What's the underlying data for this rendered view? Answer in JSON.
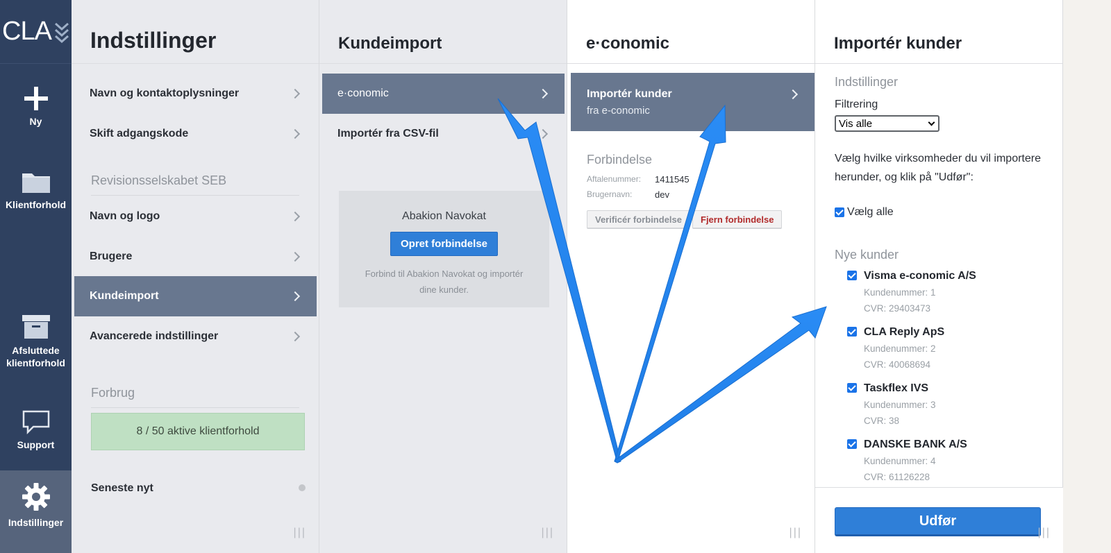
{
  "rail": {
    "logo": "CLA",
    "items": [
      {
        "label": "Ny"
      },
      {
        "label": "Klientforhold"
      },
      {
        "label": "Afsluttede klientforhold"
      },
      {
        "label": "Support"
      },
      {
        "label": "Indstillinger"
      }
    ]
  },
  "settings": {
    "title": "Indstillinger",
    "items": [
      {
        "label": "Navn og kontaktoplysninger"
      },
      {
        "label": "Skift adgangskode"
      },
      {
        "label": "Navn og logo"
      },
      {
        "label": "Brugere"
      },
      {
        "label": "Kundeimport"
      },
      {
        "label": "Avancerede indstillinger"
      }
    ],
    "company_section": "Revisionsselskabet SEB",
    "usage_section": "Forbrug",
    "usage_text": "8 / 50 aktive klientforhold",
    "news": "Seneste nyt"
  },
  "import": {
    "title": "Kundeimport",
    "items": [
      {
        "label": "e·conomic"
      },
      {
        "label": "Importér fra CSV-fil"
      }
    ],
    "card": {
      "title": "Abakion Navokat",
      "button": "Opret forbindelse",
      "desc": "Forbind til Abakion Navokat og importér dine kunder."
    }
  },
  "economic": {
    "title": "e·conomic",
    "item_line1": "Importér kunder",
    "item_line2": "fra e-conomic",
    "conn_title": "Forbindelse",
    "agreement_label": "Aftalenummer:",
    "agreement_value": "1411545",
    "user_label": "Brugernavn:",
    "user_value": "dev",
    "verify_button": "Verificér forbindelse",
    "remove_button": "Fjern forbindelse"
  },
  "importpanel": {
    "title": "Importér kunder",
    "settings_section": "Indstillinger",
    "filter_label": "Filtrering",
    "filter_value": "Vis alle",
    "instructions": "Vælg hvilke virksomheder du vil importere herunder, og klik på \"Udfør\":",
    "select_all": "Vælg alle",
    "new_section": "Nye kunder",
    "customers": [
      {
        "name": "Visma e-conomic A/S",
        "number": "Kundenummer: 1",
        "cvr": "CVR: 29403473"
      },
      {
        "name": "CLA Reply ApS",
        "number": "Kundenummer: 2",
        "cvr": "CVR: 40068694"
      },
      {
        "name": "Taskflex IVS",
        "number": "Kundenummer: 3",
        "cvr": "CVR: 38"
      },
      {
        "name": "DANSKE BANK A/S",
        "number": "Kundenummer: 4",
        "cvr": "CVR: 61126228"
      }
    ],
    "submit": "Udfør"
  },
  "colors": {
    "rail": "#2f4160",
    "selected": "#68778f",
    "primary": "#2f7fd8",
    "usage_bg": "#bfe0c3",
    "arrow": "#2b8cf2"
  }
}
